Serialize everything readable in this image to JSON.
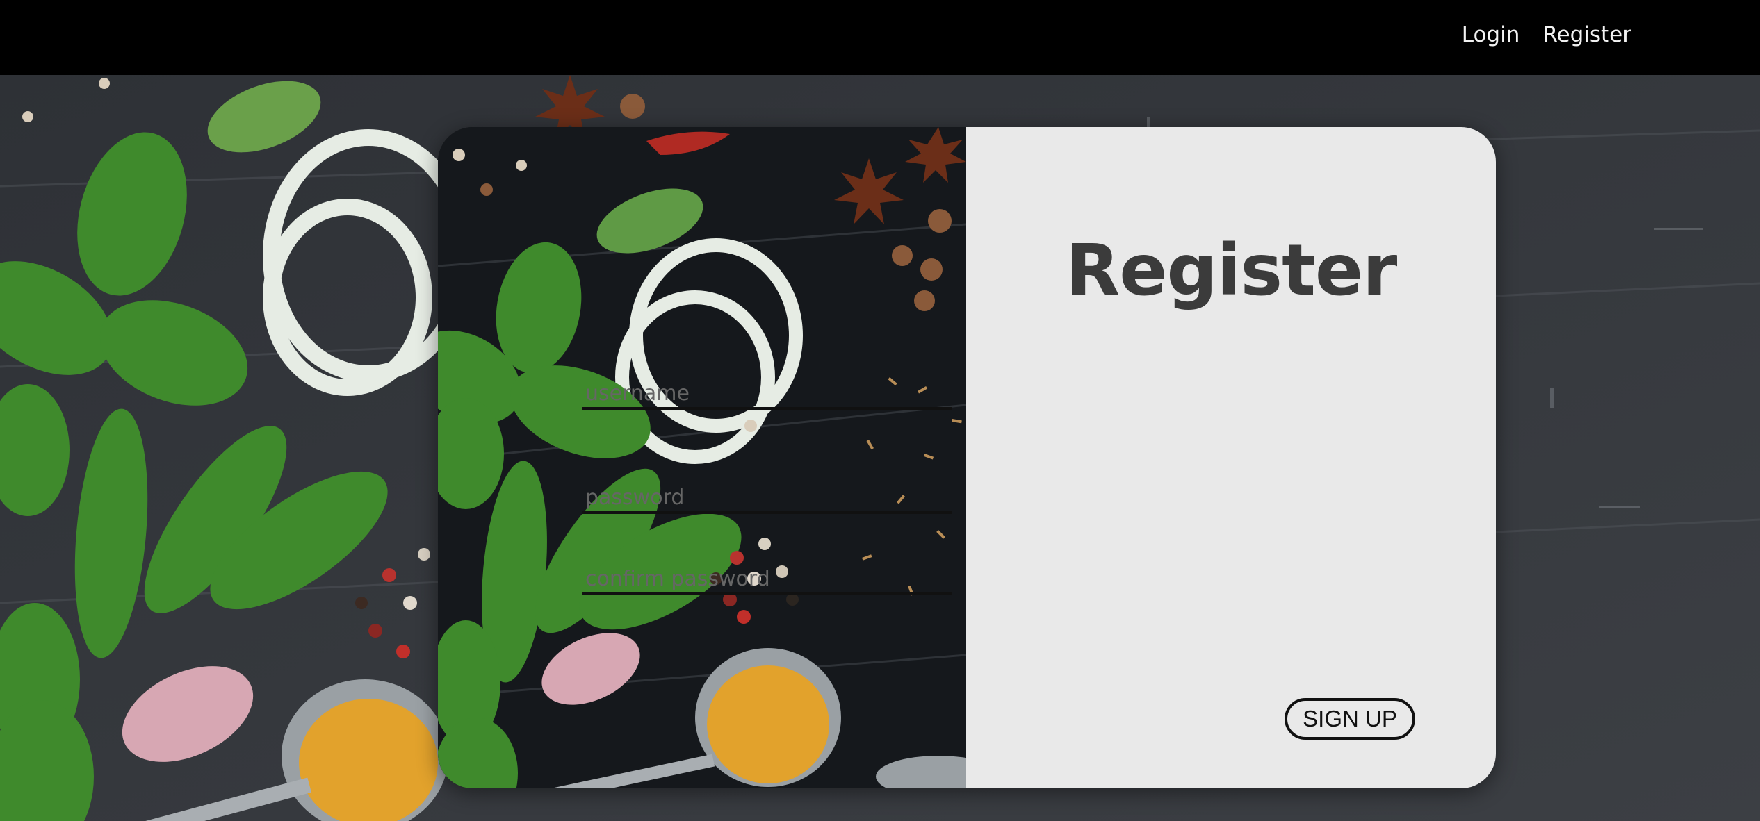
{
  "nav": {
    "login_label": "Login",
    "register_label": "Register"
  },
  "form": {
    "title": "Register",
    "username_placeholder": "username",
    "password_placeholder": "password",
    "confirm_password_placeholder": "confirm password",
    "submit_label": "SIGN UP"
  },
  "colors": {
    "navbar": "#000000",
    "form_panel": "#e9e9e9",
    "title_text": "#3b3b3b",
    "background": "#3a3c40"
  },
  "icons": {
    "hero": "spices-herbs-photo"
  }
}
